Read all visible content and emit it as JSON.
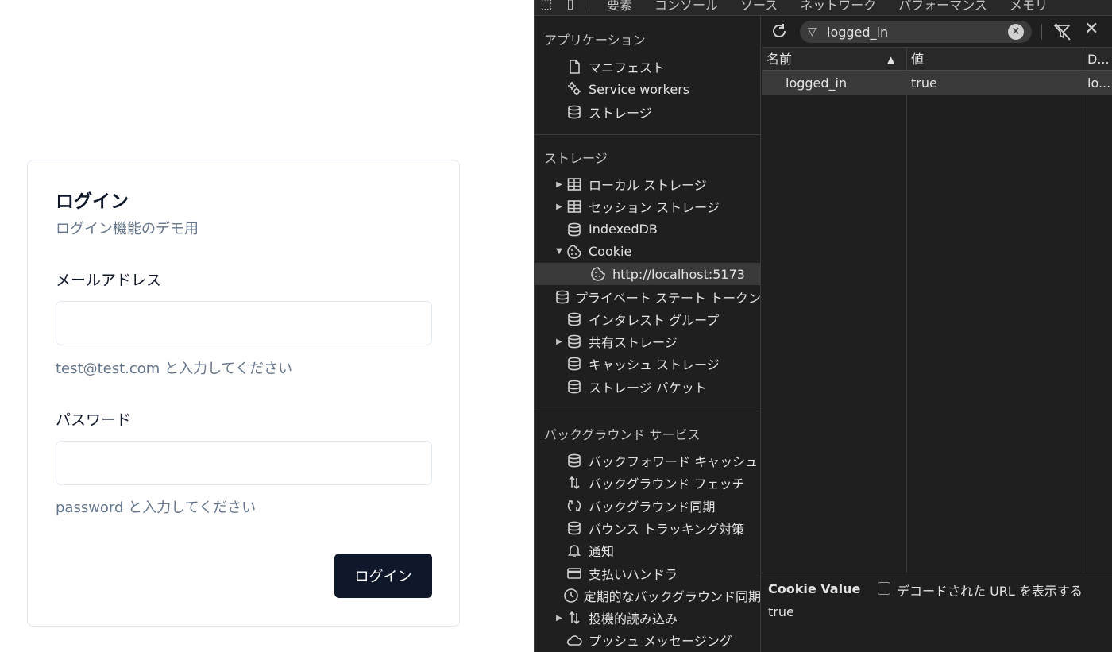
{
  "app": {
    "title": "ログイン",
    "description": "ログイン機能のデモ用",
    "email_label": "メールアドレス",
    "email_value": "",
    "email_help": "test@test.com と入力してください",
    "password_label": "パスワード",
    "password_value": "",
    "password_help": "password と入力してください",
    "login_button": "ログイン"
  },
  "devtools": {
    "tabs": [
      "要素",
      "コンソール",
      "ソース",
      "ネットワーク",
      "パフォーマンス",
      "メモリ"
    ],
    "sidebar": {
      "application_title": "アプリケーション",
      "application_items": [
        {
          "icon": "file-icon",
          "label": "マニフェスト"
        },
        {
          "icon": "gears-icon",
          "label": "Service workers"
        },
        {
          "icon": "database-icon",
          "label": "ストレージ"
        }
      ],
      "storage_title": "ストレージ",
      "storage_items": [
        {
          "icon": "table-icon",
          "label": "ローカル ストレージ",
          "expand": "▶"
        },
        {
          "icon": "table-icon",
          "label": "セッション ストレージ",
          "expand": "▶"
        },
        {
          "icon": "database-icon",
          "label": "IndexedDB",
          "expand": ""
        },
        {
          "icon": "cookie-icon",
          "label": "Cookie",
          "expand": "▼"
        },
        {
          "icon": "cookie-icon",
          "label": "http://localhost:5173",
          "expand": "",
          "child": true,
          "selected": true
        },
        {
          "icon": "database-icon",
          "label": "プライベート ステート トークン",
          "expand": ""
        },
        {
          "icon": "database-icon",
          "label": "インタレスト グループ",
          "expand": ""
        },
        {
          "icon": "database-icon",
          "label": "共有ストレージ",
          "expand": "▶"
        },
        {
          "icon": "database-icon",
          "label": "キャッシュ ストレージ",
          "expand": ""
        },
        {
          "icon": "database-icon",
          "label": "ストレージ バケット",
          "expand": ""
        }
      ],
      "background_title": "バックグラウンド サービス",
      "background_items": [
        {
          "icon": "database-icon",
          "label": "バックフォワード キャッシュ",
          "expand": ""
        },
        {
          "icon": "updown-arrows-icon",
          "label": "バックグラウンド フェッチ",
          "expand": ""
        },
        {
          "icon": "sync-icon",
          "label": "バックグラウンド同期",
          "expand": ""
        },
        {
          "icon": "database-icon",
          "label": "バウンス トラッキング対策",
          "expand": ""
        },
        {
          "icon": "bell-icon",
          "label": "通知",
          "expand": ""
        },
        {
          "icon": "card-icon",
          "label": "支払いハンドラ",
          "expand": ""
        },
        {
          "icon": "clock-icon",
          "label": "定期的なバックグラウンド同期",
          "expand": ""
        },
        {
          "icon": "updown-arrows-icon",
          "label": "投機的読み込み",
          "expand": "▶"
        },
        {
          "icon": "cloud-icon",
          "label": "プッシュ メッセージング",
          "expand": ""
        }
      ]
    },
    "filter": {
      "value": "logged_in"
    },
    "table": {
      "headers": {
        "name": "名前",
        "sort_indicator": "▲",
        "value": "値",
        "domain": "D..."
      },
      "rows": [
        {
          "name": "logged_in",
          "value": "true",
          "domain": "lo..."
        }
      ]
    },
    "cookie_value": {
      "title": "Cookie Value",
      "checkbox_label": "デコードされた URL を表示する",
      "value": "true"
    }
  }
}
